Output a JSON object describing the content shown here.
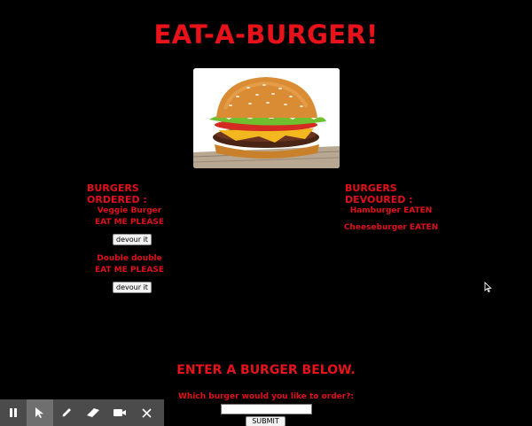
{
  "page": {
    "title": "EAT-A-BURGER!"
  },
  "hero_image": {
    "alt": "burger"
  },
  "ordered": {
    "heading": "BURGERS ORDERED :",
    "items": [
      {
        "name": "Veggie Burger",
        "status": "EAT ME PLEASE",
        "button": "devour it"
      },
      {
        "name": "Double double",
        "status": "EAT ME PLEASE",
        "button": "devour it"
      }
    ]
  },
  "devoured": {
    "heading": "BURGERS DEVOURED :",
    "items": [
      {
        "label": "Hamburger EATEN"
      },
      {
        "label": "Cheeseburger EATEN"
      }
    ]
  },
  "form": {
    "heading": "ENTER A BURGER BELOW.",
    "label": "Which burger would you like to order?:",
    "input_value": "",
    "input_placeholder": "",
    "submit_label": "SUBMIT"
  },
  "recording_toolbar": {
    "tools": [
      {
        "icon": "pause-icon"
      },
      {
        "icon": "pointer-icon",
        "active": true
      },
      {
        "icon": "pen-icon"
      },
      {
        "icon": "eraser-icon"
      },
      {
        "icon": "camera-icon"
      },
      {
        "icon": "close-icon"
      }
    ]
  },
  "colors": {
    "background": "#000000",
    "accent": "#e8121b",
    "toolbar": "#4b4b4b"
  }
}
